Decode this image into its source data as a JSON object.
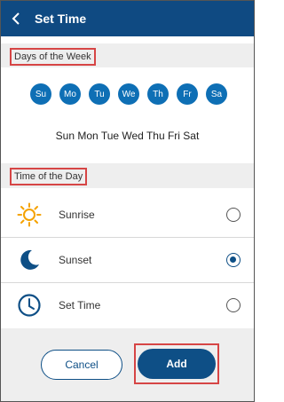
{
  "header": {
    "title": "Set Time"
  },
  "days_section": {
    "label": "Days of the Week",
    "days": [
      "Su",
      "Mo",
      "Tu",
      "We",
      "Th",
      "Fr",
      "Sa"
    ],
    "summary": "Sun Mon Tue Wed Thu Fri Sat"
  },
  "time_section": {
    "label": "Time of the Day",
    "options": [
      {
        "label": "Sunrise",
        "icon": "sunrise-icon",
        "selected": false
      },
      {
        "label": "Sunset",
        "icon": "moon-icon",
        "selected": true
      },
      {
        "label": "Set Time",
        "icon": "clock-icon",
        "selected": false
      }
    ]
  },
  "footer": {
    "cancel_label": "Cancel",
    "add_label": "Add"
  },
  "colors": {
    "header_bg": "#0f4a82",
    "day_circle": "#0e6fb5",
    "accent": "#0e4f86",
    "icon_orange": "#f5a200",
    "highlight": "#d64545"
  }
}
